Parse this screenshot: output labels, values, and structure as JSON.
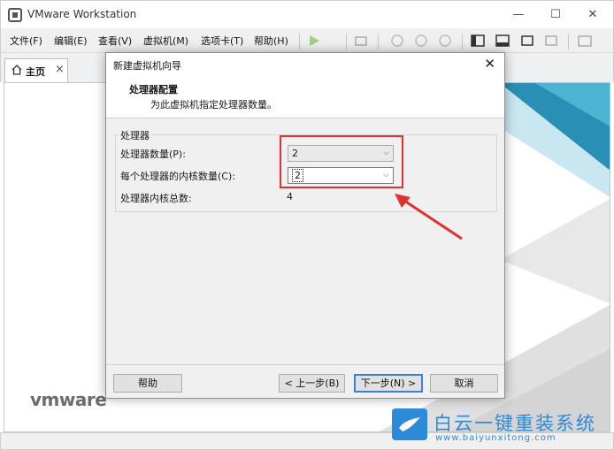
{
  "window": {
    "title": "VMware Workstation",
    "minimize": "—",
    "maximize": "☐",
    "close": "✕"
  },
  "menu": [
    "文件(F)",
    "编辑(E)",
    "查看(V)",
    "虚拟机(M)",
    "选项卡(T)",
    "帮助(H)"
  ],
  "tab": {
    "label": "主页",
    "close": "×"
  },
  "brand": "vmware",
  "dialog": {
    "title": "新建虚拟机向导",
    "close": "✕",
    "header_title": "处理器配置",
    "header_subtitle": "为此虚拟机指定处理器数量。",
    "group_label": "处理器",
    "processor_count_label": "处理器数量(P):",
    "processor_count_value": "2",
    "cores_label": "每个处理器的内核数量(C):",
    "cores_value": "2",
    "total_label": "处理器内核总数:",
    "total_value": "4",
    "help_button": "帮助",
    "back_button": "< 上一步(B)",
    "next_button": "下一步(N) >",
    "cancel_button": "取消"
  },
  "watermark": {
    "title": "白云一键重装系统",
    "url": "www.baiyunxitong.com"
  },
  "colors": {
    "highlight": "#e03030",
    "accent": "#3c7fd6",
    "watermark": "#2d8ad8"
  }
}
